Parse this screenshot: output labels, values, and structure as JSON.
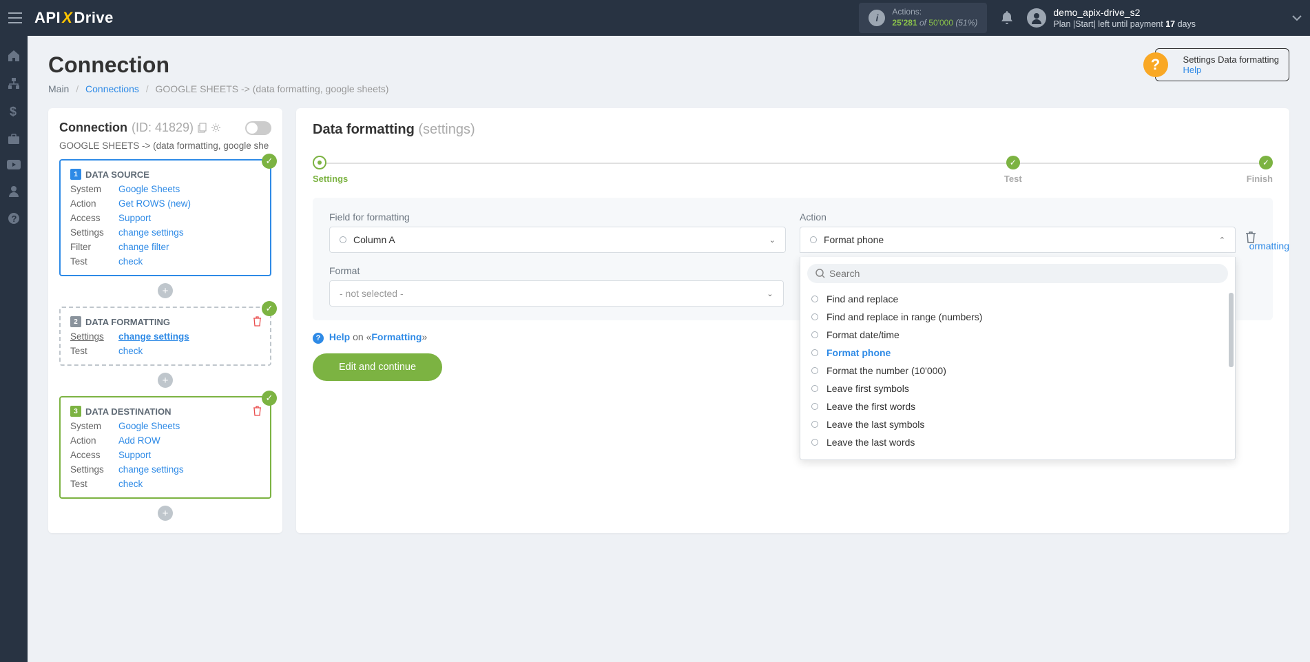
{
  "header": {
    "logo": {
      "api": "API",
      "x": "X",
      "drive": "Drive"
    },
    "actions": {
      "label": "Actions:",
      "used": "25'281",
      "of": "of",
      "total": "50'000",
      "pct": "(51%)"
    },
    "user": {
      "name": "demo_apix-drive_s2",
      "plan_prefix": "Plan |Start| left until payment ",
      "days": "17",
      "days_suffix": " days"
    }
  },
  "leftnav": [
    "home",
    "sitemap",
    "dollar",
    "briefcase",
    "video",
    "user",
    "question"
  ],
  "page": {
    "title": "Connection",
    "breadcrumb": {
      "main": "Main",
      "connections": "Connections",
      "current": "GOOGLE SHEETS -> (data formatting, google sheets)"
    },
    "help_tooltip": {
      "title": "Settings Data formatting",
      "link": "Help"
    }
  },
  "sidecard": {
    "title": "Connection",
    "id": "(ID: 41829)",
    "desc": "GOOGLE SHEETS -> (data formatting, google she",
    "steps": [
      {
        "n": "1",
        "title": "DATA SOURCE",
        "rows": [
          {
            "label": "System",
            "value": "Google Sheets"
          },
          {
            "label": "Action",
            "value": "Get ROWS (new)"
          },
          {
            "label": "Access",
            "value": "Support"
          },
          {
            "label": "Settings",
            "value": "change settings"
          },
          {
            "label": "Filter",
            "value": "change filter"
          },
          {
            "label": "Test",
            "value": "check"
          }
        ]
      },
      {
        "n": "2",
        "title": "DATA FORMATTING",
        "rows": [
          {
            "label": "Settings",
            "value": "change settings",
            "underline": true,
            "bold": true
          },
          {
            "label": "Test",
            "value": "check"
          }
        ]
      },
      {
        "n": "3",
        "title": "DATA DESTINATION",
        "rows": [
          {
            "label": "System",
            "value": "Google Sheets"
          },
          {
            "label": "Action",
            "value": "Add ROW"
          },
          {
            "label": "Access",
            "value": "Support"
          },
          {
            "label": "Settings",
            "value": "change settings"
          },
          {
            "label": "Test",
            "value": "check"
          }
        ]
      }
    ]
  },
  "content": {
    "title": "Data formatting",
    "subtitle": "(settings)",
    "stepper": [
      {
        "label": "Settings",
        "state": "curr"
      },
      {
        "label": "Test",
        "state": "done"
      },
      {
        "label": "Finish",
        "state": "done"
      }
    ],
    "form": {
      "field_label": "Field for formatting",
      "field_value": "Column A",
      "action_label": "Action",
      "action_value": "Format phone",
      "format_label": "Format",
      "format_value": "- not selected -",
      "search_placeholder": "Search",
      "options": [
        "Find and replace",
        "Find and replace in range (numbers)",
        "Format date/time",
        "Format phone",
        "Format the number (10'000)",
        "Leave first symbols",
        "Leave the first words",
        "Leave the last symbols",
        "Leave the last words"
      ],
      "selected": "Format phone"
    },
    "help": {
      "text": "Help",
      "on": " on «",
      "link": "Formatting",
      "close": "»"
    },
    "add_formatting": "ormatting",
    "button": "Edit and continue"
  }
}
